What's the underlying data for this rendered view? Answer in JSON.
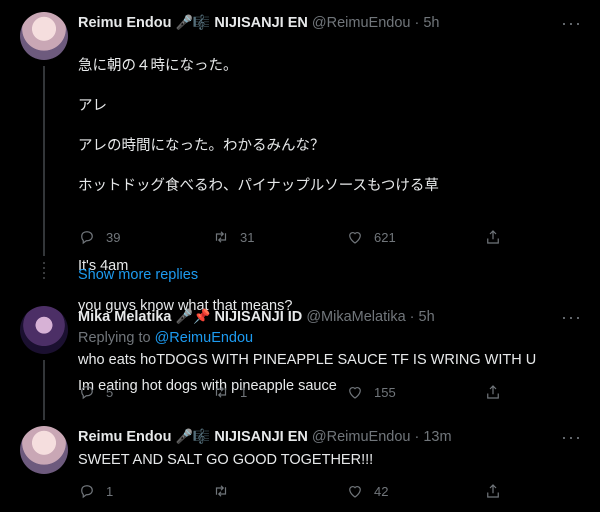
{
  "tweets": [
    {
      "name": "Reimu Endou",
      "badges": "🎤🎼",
      "org": "NIJISANJI EN",
      "handle": "@ReimuEndou",
      "time": "· 5h",
      "lines": [
        "急に朝の４時になった。",
        "アレ",
        "アレの時間になった。わかるみんな？",
        "ホットドッグ食べるわ、パイナップルソースもつける草",
        "",
        "It's 4am",
        "you guys know what that means?",
        "",
        "Im eating hot dogs with pineapple sauce"
      ],
      "replies": "39",
      "retweets": "31",
      "likes": "621"
    },
    {
      "name": "Mika Melatika",
      "badges": "🎤📌",
      "org": "NIJISANJI ID",
      "handle": "@MikaMelatika",
      "time": "· 5h",
      "replying_prefix": "Replying to",
      "replying_to": "@ReimuEndou",
      "text": "who eats hoTDOGS WITH PINEAPPLE SAUCE TF IS WRING WITH U",
      "replies": "5",
      "retweets": "1",
      "likes": "155"
    },
    {
      "name": "Reimu Endou",
      "badges": "🎤🎼",
      "org": "NIJISANJI EN",
      "handle": "@ReimuEndou",
      "time": "· 13m",
      "text": "SWEET AND SALT GO GOOD TOGETHER!!!",
      "replies": "1",
      "retweets": "",
      "likes": "42"
    }
  ],
  "show_more": "Show more replies",
  "more_icon": "···",
  "icons": [
    "reply-icon",
    "retweet-icon",
    "like-icon",
    "share-icon"
  ]
}
